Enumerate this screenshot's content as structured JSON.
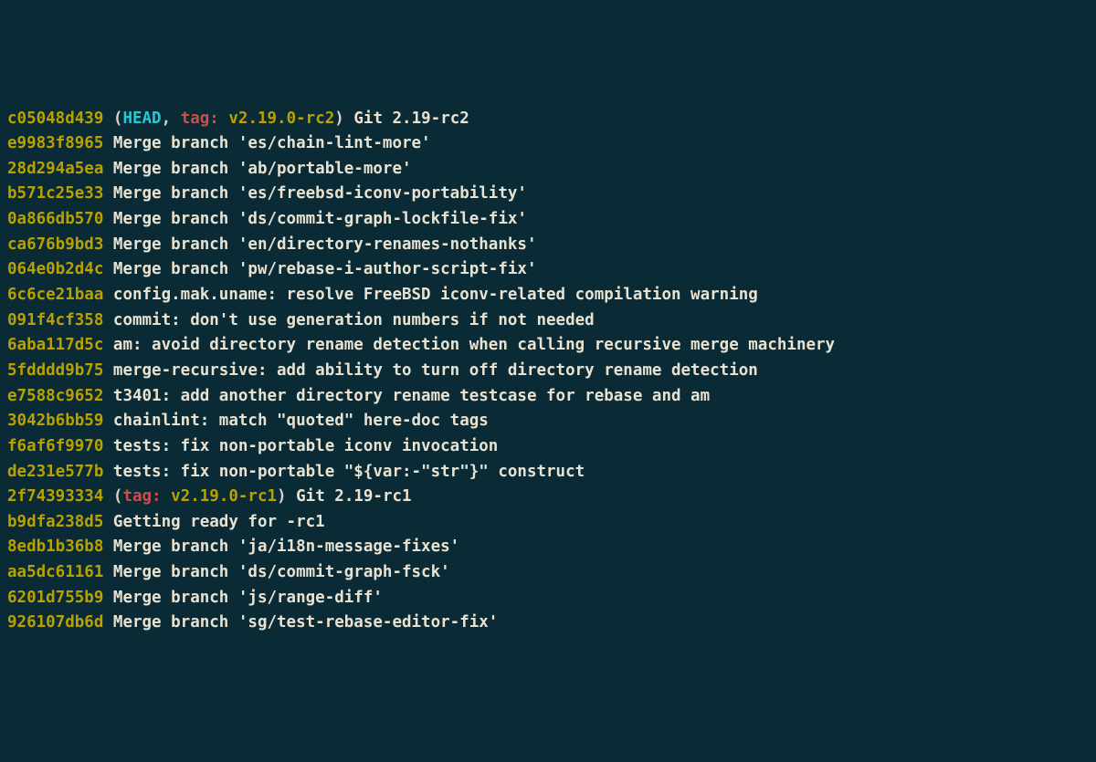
{
  "log": [
    {
      "hash": "c05048d439",
      "refs": {
        "head": "HEAD",
        "tag": "v2.19.0-rc2"
      },
      "msg": "Git 2.19-rc2"
    },
    {
      "hash": "e9983f8965",
      "msg": "Merge branch 'es/chain-lint-more'"
    },
    {
      "hash": "28d294a5ea",
      "msg": "Merge branch 'ab/portable-more'"
    },
    {
      "hash": "b571c25e33",
      "msg": "Merge branch 'es/freebsd-iconv-portability'"
    },
    {
      "hash": "0a866db570",
      "msg": "Merge branch 'ds/commit-graph-lockfile-fix'"
    },
    {
      "hash": "ca676b9bd3",
      "msg": "Merge branch 'en/directory-renames-nothanks'"
    },
    {
      "hash": "064e0b2d4c",
      "msg": "Merge branch 'pw/rebase-i-author-script-fix'"
    },
    {
      "hash": "6c6ce21baa",
      "msg": "config.mak.uname: resolve FreeBSD iconv-related compilation warning"
    },
    {
      "hash": "091f4cf358",
      "msg": "commit: don't use generation numbers if not needed"
    },
    {
      "hash": "6aba117d5c",
      "msg": "am: avoid directory rename detection when calling recursive merge machinery"
    },
    {
      "hash": "5fdddd9b75",
      "msg": "merge-recursive: add ability to turn off directory rename detection"
    },
    {
      "hash": "e7588c9652",
      "msg": "t3401: add another directory rename testcase for rebase and am"
    },
    {
      "hash": "3042b6bb59",
      "msg": "chainlint: match \"quoted\" here-doc tags"
    },
    {
      "hash": "f6af6f9970",
      "msg": "tests: fix non-portable iconv invocation"
    },
    {
      "hash": "de231e577b",
      "msg": "tests: fix non-portable \"${var:-\"str\"}\" construct"
    },
    {
      "hash": "2f74393334",
      "refs": {
        "tag": "v2.19.0-rc1"
      },
      "msg": "Git 2.19-rc1"
    },
    {
      "hash": "b9dfa238d5",
      "msg": "Getting ready for -rc1"
    },
    {
      "hash": "8edb1b36b8",
      "msg": "Merge branch 'ja/i18n-message-fixes'"
    },
    {
      "hash": "aa5dc61161",
      "msg": "Merge branch 'ds/commit-graph-fsck'"
    },
    {
      "hash": "6201d755b9",
      "msg": "Merge branch 'js/range-diff'"
    },
    {
      "hash": "926107db6d",
      "msg": "Merge branch 'sg/test-rebase-editor-fix'"
    }
  ],
  "labels": {
    "tag_prefix": "tag: "
  }
}
